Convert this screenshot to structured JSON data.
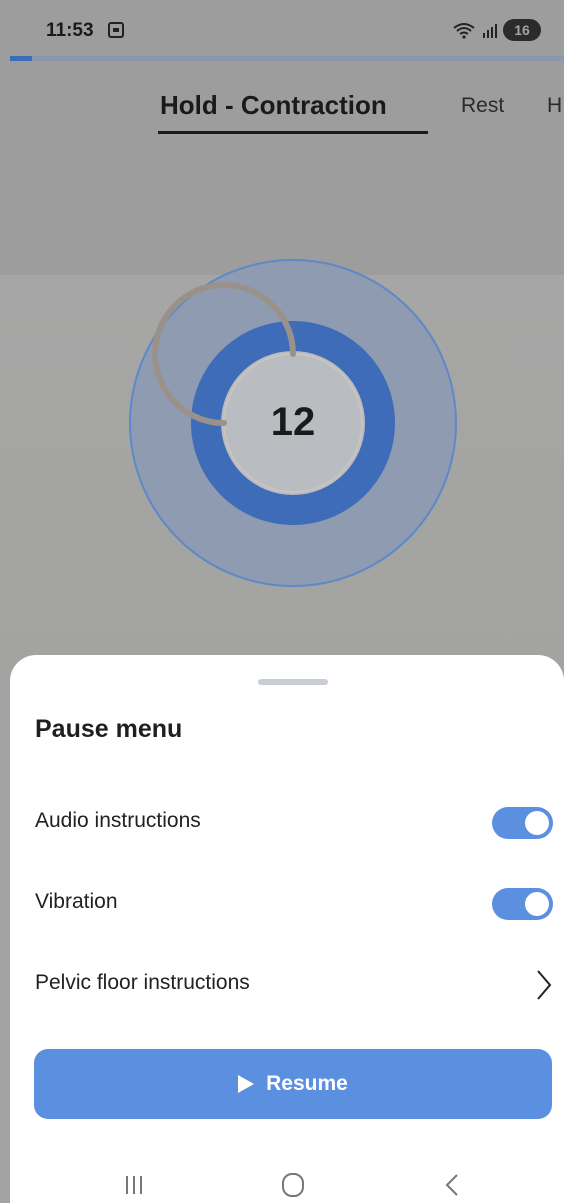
{
  "status_bar": {
    "time": "11:53",
    "battery": "16",
    "icons": [
      "screenshot-icon",
      "wifi-icon",
      "signal-icon",
      "battery-icon"
    ]
  },
  "progress": {
    "fraction": 0.04
  },
  "tabs": [
    {
      "label": "Hold - Contraction",
      "active": true
    },
    {
      "label": "Rest",
      "active": false
    },
    {
      "label": "H",
      "active": false
    }
  ],
  "timer": {
    "value": "12",
    "ring_progress": 0.75
  },
  "sheet": {
    "title": "Pause menu",
    "audio": {
      "label": "Audio instructions",
      "on": true
    },
    "vibration": {
      "label": "Vibration",
      "on": true
    },
    "pelvic": {
      "label": "Pelvic floor instructions"
    },
    "resume_label": "Resume"
  },
  "colors": {
    "accent": "#5b8fe0",
    "ring_dark": "#3f6cb8",
    "ring_outer": "#8e9bb0",
    "overlay_bg": "#a3a3a3"
  },
  "nav": {
    "icons": [
      "recent-apps-icon",
      "home-icon",
      "back-icon"
    ]
  }
}
